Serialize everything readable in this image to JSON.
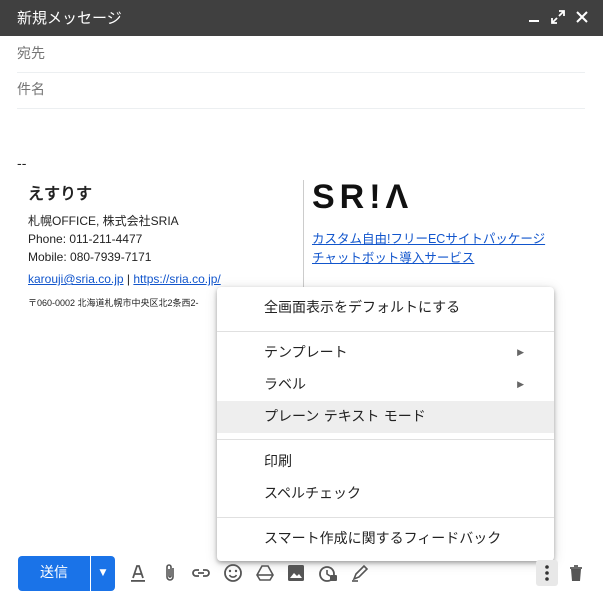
{
  "window": {
    "title": "新規メッセージ",
    "minimize": "minimize",
    "expand": "expand",
    "close": "close"
  },
  "fields": {
    "to_placeholder": "宛先",
    "subject_placeholder": "件名"
  },
  "signature": {
    "dash": "--",
    "name": "えすりす",
    "company": "札幌OFFICE, 株式会社SRIA",
    "phone": "Phone: 011-211-4477",
    "mobile": "Mobile: 080-7939-7171",
    "email": "karouji@sria.co.jp",
    "separator": "|",
    "website": "https://sria.co.jp/",
    "address": "〒060-0002 北海道札幌市中央区北2条西2-",
    "logo": "SR!Λ",
    "service_links": [
      "カスタム自由!フリーECサイトパッケージ",
      "チャットボット導入サービス"
    ]
  },
  "menu": {
    "items": [
      {
        "label": "全画面表示をデフォルトにする",
        "submenu": false
      },
      {
        "label": "テンプレート",
        "submenu": true
      },
      {
        "label": "ラベル",
        "submenu": true
      },
      {
        "label": "プレーン テキスト モード",
        "submenu": false,
        "highlighted": true
      },
      {
        "label": "印刷",
        "submenu": false
      },
      {
        "label": "スペルチェック",
        "submenu": false
      },
      {
        "label": "スマート作成に関するフィードバック",
        "submenu": false
      }
    ]
  },
  "toolbar": {
    "send_label": "送信",
    "accent": "#1a73e8",
    "icons": [
      "format-text-icon",
      "attach-icon",
      "link-icon",
      "emoji-icon",
      "drive-icon",
      "photo-icon",
      "confidential-icon",
      "signature-icon",
      "more-options-icon",
      "trash-icon"
    ]
  }
}
